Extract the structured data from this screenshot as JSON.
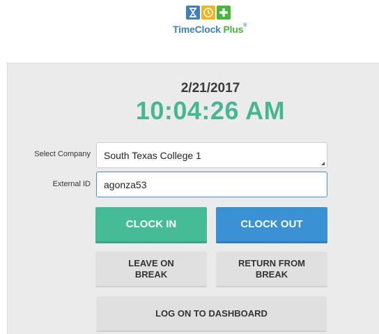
{
  "brand": {
    "name": "TimeClock",
    "name_plus": "Plus",
    "registered": "®",
    "colors": {
      "blue": "#3d7fc1",
      "yellow": "#f0b41e",
      "green": "#45b83c"
    },
    "icons": [
      "hourglass-icon",
      "clock-icon",
      "plus-icon"
    ]
  },
  "clock": {
    "date": "2/21/2017",
    "time": "10:04:26 AM",
    "time_color": "#45b893"
  },
  "form": {
    "company_label": "Select Company",
    "company_value": "South Texas College  1",
    "external_id_label": "External ID",
    "external_id_value": "agonza53"
  },
  "buttons": {
    "clock_in": "CLOCK IN",
    "clock_out": "CLOCK OUT",
    "leave_on_break": "LEAVE ON BREAK",
    "return_from_break": "RETURN FROM BREAK",
    "log_on_dashboard": "LOG ON TO DASHBOARD",
    "colors": {
      "clock_in": "#45bb96",
      "clock_out": "#3a91d3",
      "secondary": "#e0e0e0"
    }
  }
}
